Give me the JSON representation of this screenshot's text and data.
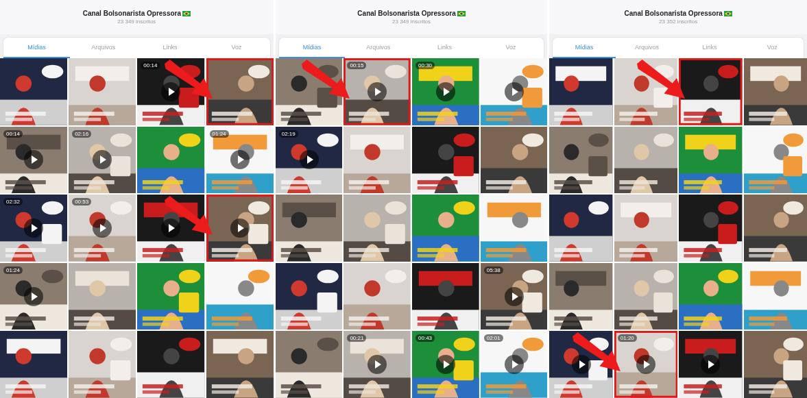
{
  "panels": [
    {
      "title": "Canal Bolsonarista Opressora",
      "subscribers": "23 349 inscritos",
      "tabs": [
        {
          "label": "Mídias",
          "selected": true
        },
        {
          "label": "Arquivos",
          "selected": false
        },
        {
          "label": "Links",
          "selected": false
        },
        {
          "label": "Voz",
          "selected": false
        }
      ],
      "tiles": [
        {
          "kind": "picture",
          "video": false,
          "highlighted": false,
          "arrow": false
        },
        {
          "kind": "picture",
          "video": false,
          "highlighted": false,
          "arrow": false
        },
        {
          "kind": "picture",
          "video": true,
          "duration": "00:14",
          "highlighted": false,
          "arrow": false
        },
        {
          "kind": "picture",
          "video": false,
          "highlighted": true,
          "arrow": true
        },
        {
          "kind": "picture",
          "video": true,
          "duration": "00:14",
          "highlighted": false,
          "arrow": false
        },
        {
          "kind": "picture",
          "video": true,
          "duration": "02:16",
          "highlighted": false,
          "arrow": false
        },
        {
          "kind": "picture",
          "video": false,
          "highlighted": false,
          "arrow": false
        },
        {
          "kind": "picture",
          "video": true,
          "duration": "01:24",
          "highlighted": false,
          "arrow": false
        },
        {
          "kind": "picture",
          "video": true,
          "duration": "02:32",
          "highlighted": false,
          "arrow": false
        },
        {
          "kind": "picture",
          "video": true,
          "duration": "00:53",
          "highlighted": false,
          "arrow": false
        },
        {
          "kind": "picture",
          "video": true,
          "highlighted": false,
          "arrow": false
        },
        {
          "kind": "picture",
          "video": true,
          "highlighted": true,
          "arrow": true
        },
        {
          "kind": "picture",
          "video": true,
          "duration": "01:24",
          "highlighted": false,
          "arrow": false
        },
        {
          "kind": "picture",
          "video": false,
          "highlighted": false,
          "arrow": false
        },
        {
          "kind": "picture",
          "video": false,
          "highlighted": false,
          "arrow": false
        },
        {
          "kind": "picture",
          "video": false,
          "highlighted": false,
          "arrow": false
        },
        {
          "kind": "picture",
          "video": false,
          "highlighted": false,
          "arrow": false
        },
        {
          "kind": "picture",
          "video": false,
          "highlighted": false,
          "arrow": false
        },
        {
          "kind": "picture",
          "video": false,
          "highlighted": false,
          "arrow": false
        },
        {
          "kind": "picture",
          "video": false,
          "highlighted": false,
          "arrow": false
        }
      ]
    },
    {
      "title": "Canal Bolsonarista Opressora",
      "subscribers": "23 349 inscritos",
      "tabs": [
        {
          "label": "Mídias",
          "selected": true
        },
        {
          "label": "Arquivos",
          "selected": false
        },
        {
          "label": "Links",
          "selected": false
        },
        {
          "label": "Voz",
          "selected": false
        }
      ],
      "tiles": [
        {
          "kind": "picture",
          "video": false,
          "highlighted": false,
          "arrow": false
        },
        {
          "kind": "picture",
          "video": true,
          "duration": "00:15",
          "highlighted": true,
          "arrow": true
        },
        {
          "kind": "picture",
          "video": true,
          "duration": "00:30",
          "highlighted": false,
          "arrow": false
        },
        {
          "kind": "picture",
          "video": true,
          "highlighted": false,
          "arrow": false
        },
        {
          "kind": "picture",
          "video": true,
          "duration": "02:19",
          "highlighted": false,
          "arrow": false
        },
        {
          "kind": "picture",
          "video": false,
          "highlighted": false,
          "arrow": false
        },
        {
          "kind": "picture",
          "video": false,
          "highlighted": false,
          "arrow": false
        },
        {
          "kind": "picture",
          "video": false,
          "highlighted": false,
          "arrow": false
        },
        {
          "kind": "picture",
          "video": false,
          "highlighted": false,
          "arrow": false
        },
        {
          "kind": "picture",
          "video": false,
          "highlighted": false,
          "arrow": false
        },
        {
          "kind": "picture",
          "video": false,
          "highlighted": false,
          "arrow": false
        },
        {
          "kind": "picture",
          "video": false,
          "highlighted": false,
          "arrow": false
        },
        {
          "kind": "picture",
          "video": false,
          "highlighted": false,
          "arrow": false
        },
        {
          "kind": "picture",
          "video": false,
          "highlighted": false,
          "arrow": false
        },
        {
          "kind": "picture",
          "video": false,
          "highlighted": false,
          "arrow": false
        },
        {
          "kind": "picture",
          "video": true,
          "duration": "05:38",
          "highlighted": false,
          "arrow": false
        },
        {
          "kind": "picture",
          "video": false,
          "highlighted": false,
          "arrow": false
        },
        {
          "kind": "picture",
          "video": true,
          "duration": "00:21",
          "highlighted": false,
          "arrow": false
        },
        {
          "kind": "picture",
          "video": true,
          "duration": "00:43",
          "highlighted": false,
          "arrow": false
        },
        {
          "kind": "picture",
          "video": true,
          "duration": "02:01",
          "highlighted": false,
          "arrow": false
        }
      ]
    },
    {
      "title": "Canal Bolsonarista Opressora",
      "subscribers": "23 352 inscritos",
      "tabs": [
        {
          "label": "Mídias",
          "selected": true
        },
        {
          "label": "Arquivos",
          "selected": false
        },
        {
          "label": "Links",
          "selected": false
        },
        {
          "label": "Voz",
          "selected": false
        }
      ],
      "tiles": [
        {
          "kind": "picture",
          "video": false,
          "highlighted": false,
          "arrow": false
        },
        {
          "kind": "picture",
          "video": false,
          "highlighted": false,
          "arrow": false
        },
        {
          "kind": "picture",
          "video": false,
          "highlighted": true,
          "arrow": true
        },
        {
          "kind": "picture",
          "video": false,
          "highlighted": false,
          "arrow": false
        },
        {
          "kind": "picture",
          "video": false,
          "highlighted": false,
          "arrow": false
        },
        {
          "kind": "picture",
          "video": false,
          "highlighted": false,
          "arrow": false
        },
        {
          "kind": "picture",
          "video": false,
          "highlighted": false,
          "arrow": false
        },
        {
          "kind": "picture",
          "video": false,
          "highlighted": false,
          "arrow": false
        },
        {
          "kind": "picture",
          "video": false,
          "highlighted": false,
          "arrow": false
        },
        {
          "kind": "picture",
          "video": false,
          "highlighted": false,
          "arrow": false
        },
        {
          "kind": "picture",
          "video": false,
          "highlighted": false,
          "arrow": false
        },
        {
          "kind": "picture",
          "video": false,
          "highlighted": false,
          "arrow": false
        },
        {
          "kind": "picture",
          "video": false,
          "highlighted": false,
          "arrow": false
        },
        {
          "kind": "picture",
          "video": false,
          "highlighted": false,
          "arrow": false
        },
        {
          "kind": "picture",
          "video": false,
          "highlighted": false,
          "arrow": false
        },
        {
          "kind": "picture",
          "video": false,
          "highlighted": false,
          "arrow": false
        },
        {
          "kind": "picture",
          "video": true,
          "highlighted": false,
          "arrow": false
        },
        {
          "kind": "picture",
          "video": true,
          "duration": "01:20",
          "highlighted": true,
          "arrow": true
        },
        {
          "kind": "picture",
          "video": true,
          "highlighted": false,
          "arrow": false
        },
        {
          "kind": "picture",
          "video": false,
          "highlighted": false,
          "arrow": false
        }
      ]
    }
  ]
}
